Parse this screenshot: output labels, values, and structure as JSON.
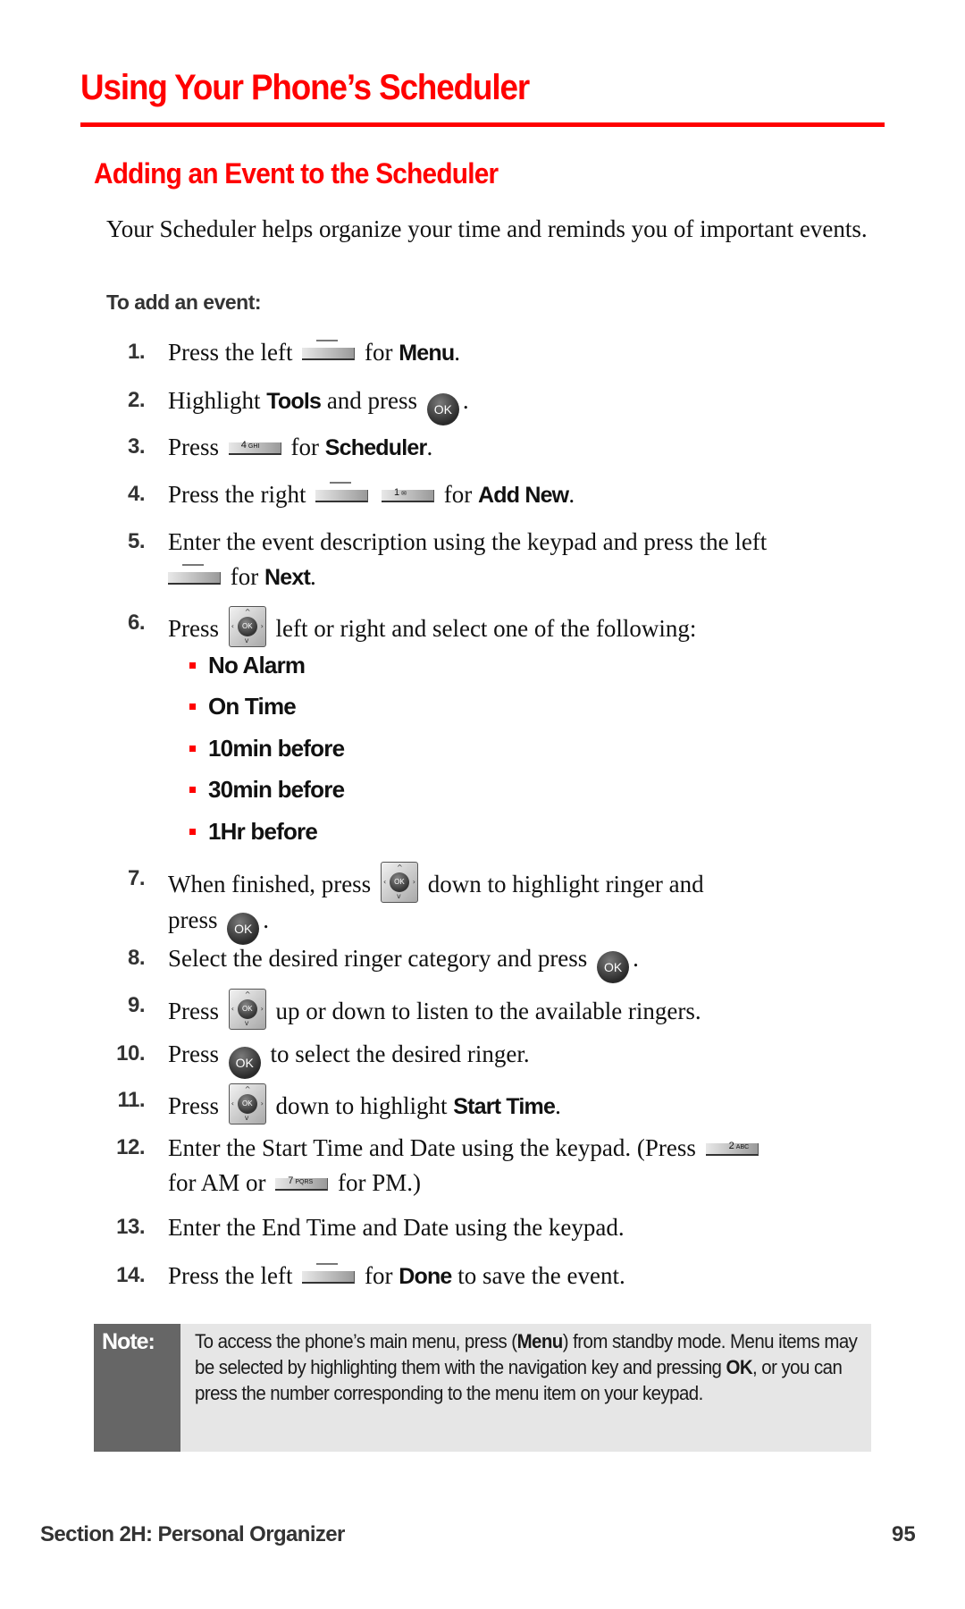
{
  "page": {
    "title": "Using Your Phone’s Scheduler",
    "subtitle": "Adding an Event to the Scheduler",
    "intro": "Your Scheduler helps organize your time and reminds you of important events.",
    "procedure_lead": "To add an event:"
  },
  "icons": {
    "ok_label": "OK",
    "key_4": {
      "digit": "4",
      "letters": "GHI"
    },
    "key_1": {
      "digit": "1",
      "letters": "✉"
    },
    "key_2": {
      "digit": "2",
      "letters": "ABC"
    },
    "key_7": {
      "digit": "7",
      "letters": "PQRS"
    },
    "nav_up": "^",
    "nav_down": "v",
    "nav_left": "‹",
    "nav_right": "›"
  },
  "steps": [
    {
      "num": "1.",
      "a": "Press the left",
      "b": "for",
      "bold": "Menu",
      "c": "."
    },
    {
      "num": "2.",
      "a": "Highlight",
      "bold": "Tools",
      "b": "and press",
      "c": "."
    },
    {
      "num": "3.",
      "a": "Press",
      "b": "for",
      "bold": "Scheduler",
      "c": "."
    },
    {
      "num": "4.",
      "a": "Press the right",
      "b": "for",
      "bold": "Add New",
      "c": "."
    },
    {
      "num": "5.",
      "a": "Enter the event description using the keypad and press the left",
      "b": "for",
      "bold": "Next",
      "c": "."
    },
    {
      "num": "6.",
      "a": "Press",
      "b": "left or right and select one of the following:"
    },
    {
      "num": "7.",
      "a": "When finished, press",
      "b": "down to highlight ringer and",
      "c": "press",
      "d": "."
    },
    {
      "num": "8.",
      "a": "Select the desired ringer category and press",
      "c": "."
    },
    {
      "num": "9.",
      "a": "Press",
      "b": "up or down to listen to the available ringers."
    },
    {
      "num": "10.",
      "a": "Press",
      "b": "to select the desired ringer."
    },
    {
      "num": "11.",
      "a": "Press",
      "b": "down to highlight",
      "bold": "Start Time",
      "c": "."
    },
    {
      "num": "12.",
      "a": "Enter the Start Time and Date using the keypad. (Press",
      "b": "for AM or",
      "c": "for PM.)"
    },
    {
      "num": "13.",
      "a": "Enter the End Time and Date using the keypad."
    },
    {
      "num": "14.",
      "a": "Press the left",
      "b": "for",
      "bold": "Done",
      "c": "to save the event."
    }
  ],
  "alarm_options": [
    "No Alarm",
    "On Time",
    "10min before",
    "30min before",
    "1Hr before"
  ],
  "note": {
    "label": "Note:",
    "t1": "To access the phone’s main menu, press (",
    "t1_bold": "Menu",
    "t2": ") from standby mode. Menu items may be selected by highlighting them with the navigation key and pressing ",
    "t2_bold": "OK",
    "t3": ", or you can press the number corresponding to the menu item on your keypad."
  },
  "footer": {
    "section": "Section 2H: Personal Organizer",
    "page_number": "95"
  },
  "colors": {
    "accent_red": "#ff0000",
    "note_dark": "#666666",
    "note_light": "#e6e6e6"
  }
}
